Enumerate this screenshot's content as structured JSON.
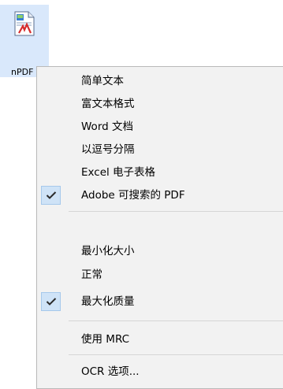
{
  "desktop_icon": {
    "label": "nPDF",
    "icon": "pdf-document-icon"
  },
  "context_menu": {
    "format_group": [
      {
        "label": "简单文本",
        "checked": false
      },
      {
        "label": "富文本格式",
        "checked": false
      },
      {
        "label": "Word 文档",
        "checked": false
      },
      {
        "label": "以逗号分隔",
        "checked": false
      },
      {
        "label": "Excel 电子表格",
        "checked": false
      },
      {
        "label": "Adobe 可搜索的 PDF",
        "checked": true
      }
    ],
    "size_group": [
      {
        "label": "最小化大小",
        "checked": false
      },
      {
        "label": "正常",
        "checked": false
      },
      {
        "label": "最大化质量",
        "checked": true
      }
    ],
    "mrc_item": {
      "label": "使用 MRC"
    },
    "ocr_item": {
      "label": "OCR 选项..."
    },
    "check_icon": "checkmark-icon",
    "colors": {
      "menu_background": "#f2f2f2",
      "check_highlight": "#cfe3f7",
      "check_mark": "#2b2b2b",
      "icon_selection": "#d9e8fb"
    }
  }
}
